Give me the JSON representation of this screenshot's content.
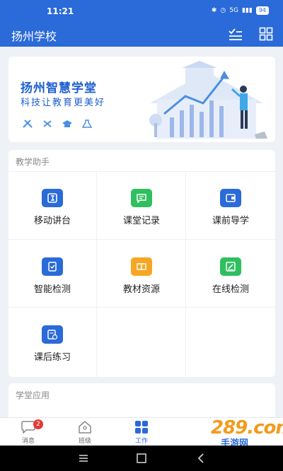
{
  "status_bar": {
    "time": "11:21",
    "signal": "5G",
    "battery": "94"
  },
  "header": {
    "title": "扬州学校"
  },
  "banner": {
    "title": "扬州智慧学堂",
    "subtitle": "科技让教育更美好"
  },
  "teaching": {
    "title": "教学助手",
    "items": [
      {
        "label": "移动讲台",
        "color": "#2a6ad9"
      },
      {
        "label": "课堂记录",
        "color": "#2fbf5f"
      },
      {
        "label": "课前导学",
        "color": "#2a6ad9"
      },
      {
        "label": "智能检测",
        "color": "#2a6ad9"
      },
      {
        "label": "教材资源",
        "color": "#f5a623"
      },
      {
        "label": "在线检测",
        "color": "#2fbf5f"
      },
      {
        "label": "课后练习",
        "color": "#2a6ad9"
      }
    ]
  },
  "apps": {
    "title": "学堂应用"
  },
  "tabs": [
    {
      "label": "消息",
      "badge": "2"
    },
    {
      "label": "班级"
    },
    {
      "label": "工作"
    }
  ],
  "watermark": {
    "text": "289.com",
    "sub": "手游网"
  },
  "colors": {
    "primary": "#2a6ad9",
    "green": "#2fbf5f",
    "orange": "#f5a623"
  }
}
